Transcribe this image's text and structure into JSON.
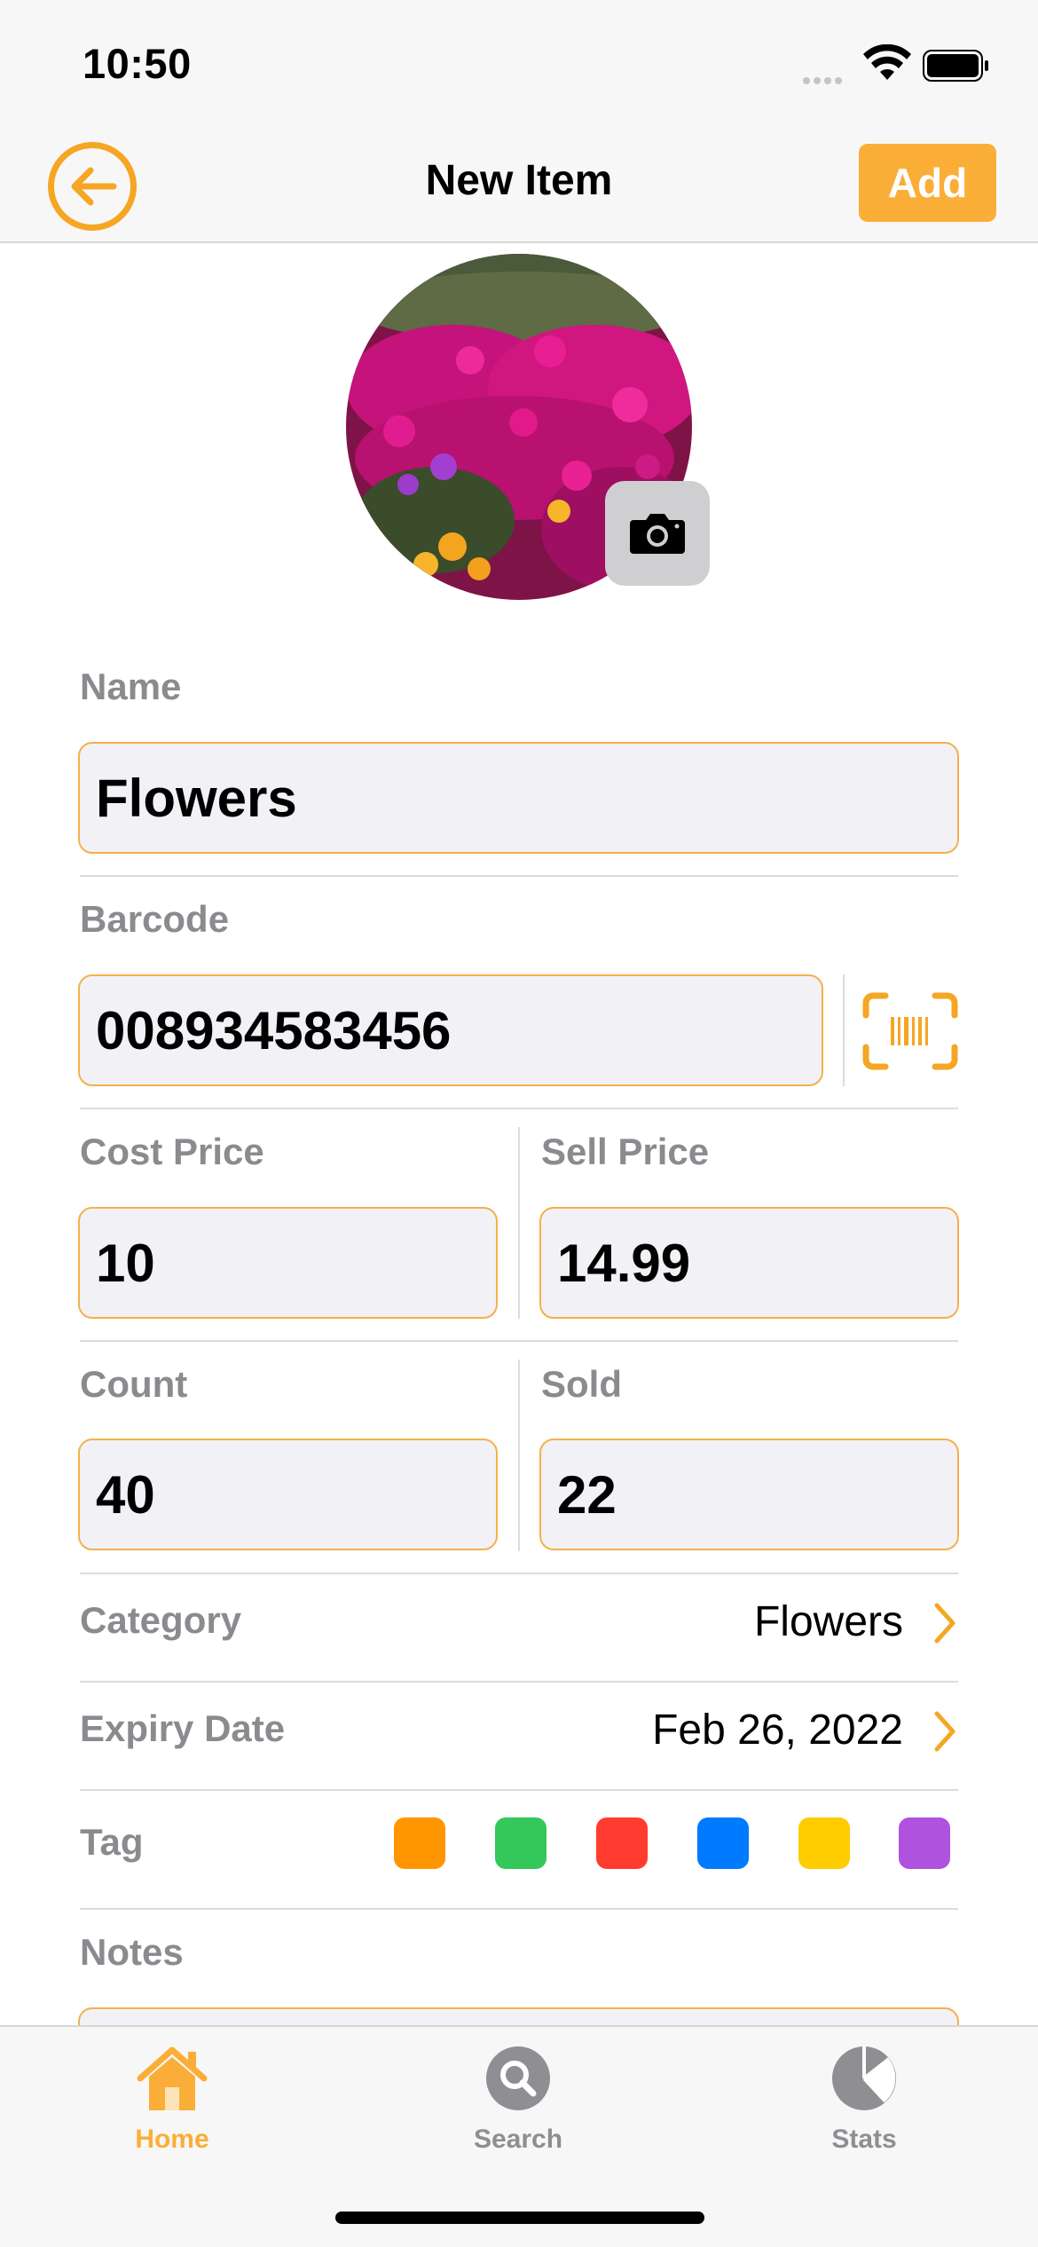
{
  "status_bar": {
    "time": "10:50"
  },
  "nav": {
    "title": "New Item",
    "add_label": "Add"
  },
  "form": {
    "name": {
      "label": "Name",
      "value": "Flowers"
    },
    "barcode": {
      "label": "Barcode",
      "value": "008934583456"
    },
    "cost_price": {
      "label": "Cost Price",
      "value": "10"
    },
    "sell_price": {
      "label": "Sell Price",
      "value": "14.99"
    },
    "count": {
      "label": "Count",
      "value": "40"
    },
    "sold": {
      "label": "Sold",
      "value": "22"
    },
    "category": {
      "label": "Category",
      "value": "Flowers"
    },
    "expiry": {
      "label": "Expiry Date",
      "value": "Feb 26, 2022"
    },
    "tag": {
      "label": "Tag",
      "colors": [
        "#ff9500",
        "#34c759",
        "#ff3b30",
        "#007aff",
        "#ffcc00",
        "#af52de"
      ]
    },
    "notes": {
      "label": "Notes"
    }
  },
  "tabs": [
    {
      "label": "Home",
      "icon": "home-icon",
      "active": true
    },
    {
      "label": "Search",
      "icon": "search-icon",
      "active": false
    },
    {
      "label": "Stats",
      "icon": "stats-icon",
      "active": false
    }
  ],
  "colors": {
    "accent": "#f5a623",
    "label": "#8b8b8f",
    "field_bg": "#f2f1f6"
  }
}
